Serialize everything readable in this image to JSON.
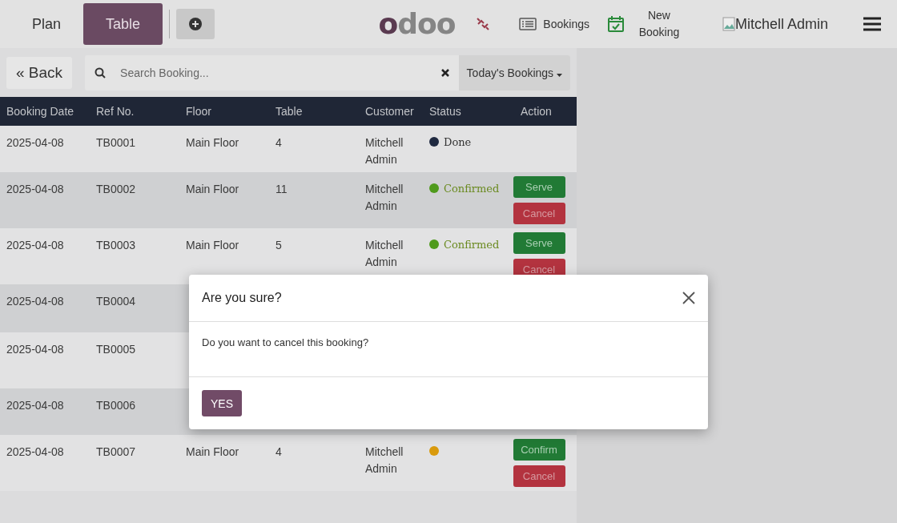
{
  "navbar": {
    "tabs": [
      {
        "label": "Plan",
        "selected": false
      },
      {
        "label": "Table",
        "selected": true
      }
    ],
    "logo": "odoo",
    "links": [
      {
        "label": "Bookings",
        "kind": "list"
      },
      {
        "label": "New Booking",
        "kind": "calendar"
      }
    ],
    "user": "Mitchell Admin"
  },
  "toolbar": {
    "back": "« Back",
    "search": {
      "placeholder": "Search Booking..."
    },
    "filter": "Today's Bookings"
  },
  "table": {
    "columns": [
      "Booking Date",
      "Ref No.",
      "Floor",
      "Table",
      "Customer",
      "Status",
      "Action"
    ],
    "rows": [
      {
        "date": "2025-04-08",
        "ref": "TB0001",
        "floor": "Main Floor",
        "table": "4",
        "customer": "Mitchell Admin",
        "status": "Done",
        "color": "#1f2940",
        "actions": []
      },
      {
        "date": "2025-04-08",
        "ref": "TB0002",
        "floor": "Main Floor",
        "table": "11",
        "customer": "Mitchell Admin",
        "status": "Confirmed",
        "color": "#4f9a1c",
        "actions": [
          {
            "label": "Serve",
            "kind": "success"
          },
          {
            "label": "Cancel",
            "kind": "danger"
          }
        ]
      },
      {
        "date": "2025-04-08",
        "ref": "TB0003",
        "floor": "Main Floor",
        "table": "5",
        "customer": "Mitchell Admin",
        "status": "Confirmed",
        "color": "#4f9a1c",
        "actions": [
          {
            "label": "Serve",
            "kind": "success"
          },
          {
            "label": "Cancel",
            "kind": "danger"
          }
        ]
      },
      {
        "date": "2025-04-08",
        "ref": "TB0004",
        "actions": []
      },
      {
        "date": "2025-04-08",
        "ref": "TB0005",
        "actions": []
      },
      {
        "date": "2025-04-08",
        "ref": "TB0006",
        "actions": []
      },
      {
        "date": "2025-04-08",
        "ref": "TB0007",
        "floor": "Main Floor",
        "table": "4",
        "customer": "Mitchell Admin",
        "color": "#d99a0c",
        "actions": [
          {
            "label": "Confirm",
            "kind": "success"
          },
          {
            "label": "Cancel",
            "kind": "danger"
          }
        ]
      }
    ]
  },
  "dialog": {
    "title": "Are you sure?",
    "message": "Do you want to cancel this booking?",
    "button": "YES"
  }
}
